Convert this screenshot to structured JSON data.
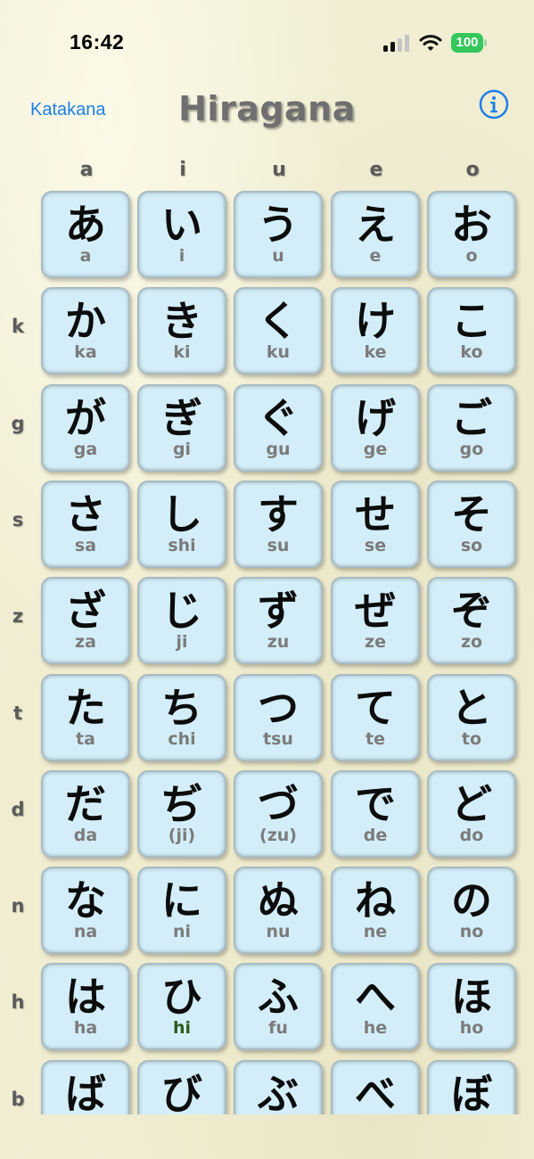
{
  "status_bar": {
    "time": "16:42",
    "battery": "100",
    "battery_color": "#34c759",
    "icons": [
      "cellular-signal-icon",
      "wifi-icon",
      "battery-icon"
    ]
  },
  "nav": {
    "katakana_label": "Katakana",
    "title": "Hiragana",
    "info_icon": "info-icon",
    "link_color": "#1e7fe8"
  },
  "columns": [
    "a",
    "i",
    "u",
    "e",
    "o"
  ],
  "rows": [
    {
      "label": "",
      "cells": [
        {
          "kana": "あ",
          "romaji": "a"
        },
        {
          "kana": "い",
          "romaji": "i"
        },
        {
          "kana": "う",
          "romaji": "u"
        },
        {
          "kana": "え",
          "romaji": "e"
        },
        {
          "kana": "お",
          "romaji": "o"
        }
      ]
    },
    {
      "label": "k",
      "cells": [
        {
          "kana": "か",
          "romaji": "ka"
        },
        {
          "kana": "き",
          "romaji": "ki"
        },
        {
          "kana": "く",
          "romaji": "ku"
        },
        {
          "kana": "け",
          "romaji": "ke"
        },
        {
          "kana": "こ",
          "romaji": "ko"
        }
      ]
    },
    {
      "label": "g",
      "cells": [
        {
          "kana": "が",
          "romaji": "ga"
        },
        {
          "kana": "ぎ",
          "romaji": "gi"
        },
        {
          "kana": "ぐ",
          "romaji": "gu"
        },
        {
          "kana": "げ",
          "romaji": "ge"
        },
        {
          "kana": "ご",
          "romaji": "go"
        }
      ]
    },
    {
      "label": "s",
      "cells": [
        {
          "kana": "さ",
          "romaji": "sa"
        },
        {
          "kana": "し",
          "romaji": "shi"
        },
        {
          "kana": "す",
          "romaji": "su"
        },
        {
          "kana": "せ",
          "romaji": "se"
        },
        {
          "kana": "そ",
          "romaji": "so"
        }
      ]
    },
    {
      "label": "z",
      "cells": [
        {
          "kana": "ざ",
          "romaji": "za"
        },
        {
          "kana": "じ",
          "romaji": "ji"
        },
        {
          "kana": "ず",
          "romaji": "zu"
        },
        {
          "kana": "ぜ",
          "romaji": "ze"
        },
        {
          "kana": "ぞ",
          "romaji": "zo"
        }
      ]
    },
    {
      "label": "t",
      "cells": [
        {
          "kana": "た",
          "romaji": "ta"
        },
        {
          "kana": "ち",
          "romaji": "chi"
        },
        {
          "kana": "つ",
          "romaji": "tsu"
        },
        {
          "kana": "て",
          "romaji": "te"
        },
        {
          "kana": "と",
          "romaji": "to"
        }
      ]
    },
    {
      "label": "d",
      "cells": [
        {
          "kana": "だ",
          "romaji": "da"
        },
        {
          "kana": "ぢ",
          "romaji": "(ji)"
        },
        {
          "kana": "づ",
          "romaji": "(zu)"
        },
        {
          "kana": "で",
          "romaji": "de"
        },
        {
          "kana": "ど",
          "romaji": "do"
        }
      ]
    },
    {
      "label": "n",
      "cells": [
        {
          "kana": "な",
          "romaji": "na"
        },
        {
          "kana": "に",
          "romaji": "ni"
        },
        {
          "kana": "ぬ",
          "romaji": "nu"
        },
        {
          "kana": "ね",
          "romaji": "ne"
        },
        {
          "kana": "の",
          "romaji": "no"
        }
      ]
    },
    {
      "label": "h",
      "cells": [
        {
          "kana": "は",
          "romaji": "ha"
        },
        {
          "kana": "ひ",
          "romaji": "hi",
          "highlight": true
        },
        {
          "kana": "ふ",
          "romaji": "fu"
        },
        {
          "kana": "へ",
          "romaji": "he"
        },
        {
          "kana": "ほ",
          "romaji": "ho"
        }
      ]
    },
    {
      "label": "b",
      "cells": [
        {
          "kana": "ば",
          "romaji": ""
        },
        {
          "kana": "び",
          "romaji": ""
        },
        {
          "kana": "ぶ",
          "romaji": ""
        },
        {
          "kana": "べ",
          "romaji": ""
        },
        {
          "kana": "ぼ",
          "romaji": ""
        }
      ]
    }
  ],
  "colors": {
    "tile_fill": "#d3eef9",
    "romaji_text": "#7b7b7b",
    "romaji_highlight": "#2f5b1c",
    "background": "#f1eed4"
  }
}
